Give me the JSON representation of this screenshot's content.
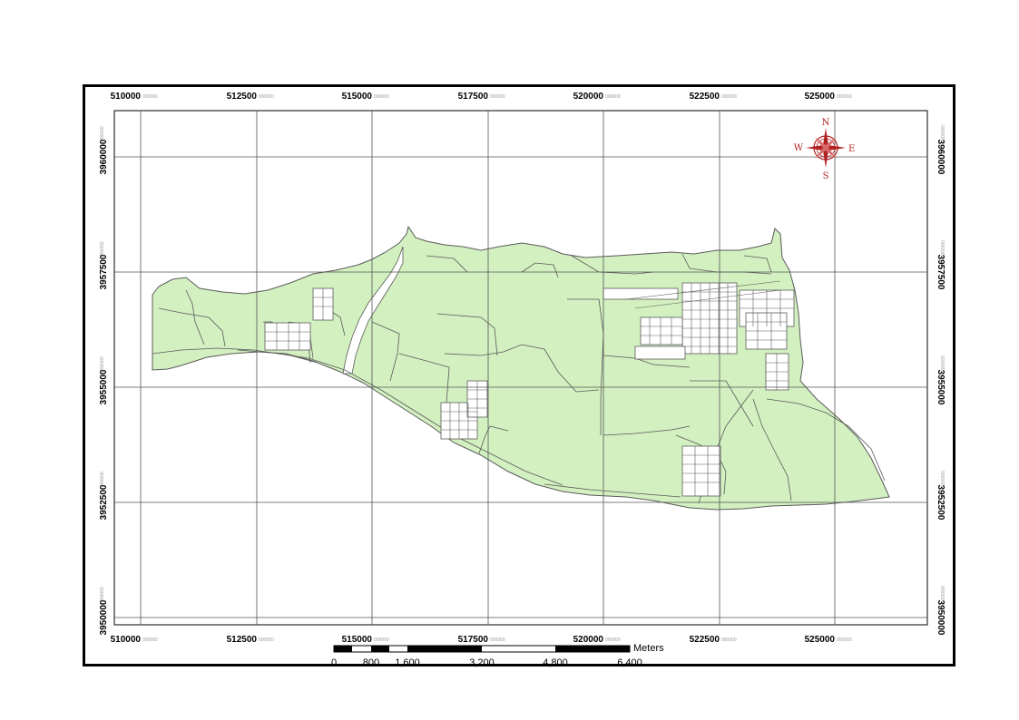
{
  "map": {
    "x_ticks": [
      "510000",
      "512500",
      "515000",
      "517500",
      "520000",
      "522500",
      "525000"
    ],
    "y_ticks": [
      "3960000",
      "3957500",
      "3955000",
      "3952500",
      "3950000"
    ],
    "tick_suffix": "000000",
    "north_arrow": {
      "n": "N",
      "s": "S",
      "e": "E",
      "w": "W",
      "color": "#b22222"
    },
    "scale_bar": {
      "unit": "Meters",
      "labels": [
        "0",
        "800",
        "1,600",
        "3,200",
        "4,800",
        "6,400"
      ]
    },
    "colors": {
      "land_fill": "#d3f0c0",
      "boundary": "#5a5a5a",
      "grid": "#555555",
      "river": "#ffffff"
    }
  }
}
